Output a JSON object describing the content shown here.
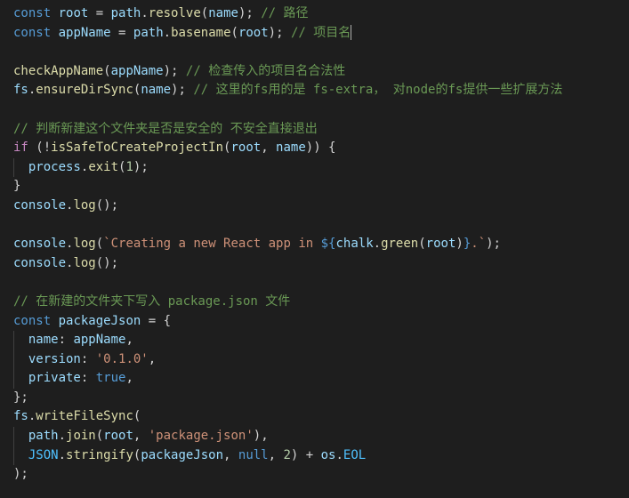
{
  "editor": {
    "lines": [
      [
        [
          "k",
          "const"
        ],
        [
          "p",
          " "
        ],
        [
          "v",
          "root"
        ],
        [
          "p",
          " = "
        ],
        [
          "v",
          "path"
        ],
        [
          "p",
          "."
        ],
        [
          "f",
          "resolve"
        ],
        [
          "p",
          "("
        ],
        [
          "v",
          "name"
        ],
        [
          "p",
          "); "
        ],
        [
          "c",
          "// 路径"
        ]
      ],
      [
        [
          "k",
          "const"
        ],
        [
          "p",
          " "
        ],
        [
          "v",
          "appName"
        ],
        [
          "p",
          " = "
        ],
        [
          "v",
          "path"
        ],
        [
          "p",
          "."
        ],
        [
          "f",
          "basename"
        ],
        [
          "p",
          "("
        ],
        [
          "v",
          "root"
        ],
        [
          "p",
          "); "
        ],
        [
          "c",
          "// 项目名"
        ]
      ],
      [],
      [
        [
          "f",
          "checkAppName"
        ],
        [
          "p",
          "("
        ],
        [
          "v",
          "appName"
        ],
        [
          "p",
          "); "
        ],
        [
          "c",
          "// 检查传入的项目名合法性"
        ]
      ],
      [
        [
          "v",
          "fs"
        ],
        [
          "p",
          "."
        ],
        [
          "f",
          "ensureDirSync"
        ],
        [
          "p",
          "("
        ],
        [
          "v",
          "name"
        ],
        [
          "p",
          "); "
        ],
        [
          "c",
          "// 这里的fs用的是 fs-extra， 对node的fs提供一些扩展方法"
        ]
      ],
      [],
      [
        [
          "c",
          "// 判断新建这个文件夹是否是安全的 不安全直接退出"
        ]
      ],
      [
        [
          "kc",
          "if"
        ],
        [
          "p",
          " (!"
        ],
        [
          "f",
          "isSafeToCreateProjectIn"
        ],
        [
          "p",
          "("
        ],
        [
          "v",
          "root"
        ],
        [
          "p",
          ", "
        ],
        [
          "v",
          "name"
        ],
        [
          "p",
          ")) {"
        ]
      ],
      [
        [
          "p",
          "  "
        ],
        [
          "v",
          "process"
        ],
        [
          "p",
          "."
        ],
        [
          "f",
          "exit"
        ],
        [
          "p",
          "("
        ],
        [
          "n",
          "1"
        ],
        [
          "p",
          ");"
        ]
      ],
      [
        [
          "p",
          "}"
        ]
      ],
      [
        [
          "v",
          "console"
        ],
        [
          "p",
          "."
        ],
        [
          "f",
          "log"
        ],
        [
          "p",
          "();"
        ]
      ],
      [],
      [
        [
          "v",
          "console"
        ],
        [
          "p",
          "."
        ],
        [
          "f",
          "log"
        ],
        [
          "p",
          "("
        ],
        [
          "s",
          "`Creating a new React app in "
        ],
        [
          "k",
          "${"
        ],
        [
          "v",
          "chalk"
        ],
        [
          "p",
          "."
        ],
        [
          "f",
          "green"
        ],
        [
          "p",
          "("
        ],
        [
          "v",
          "root"
        ],
        [
          "p",
          ")"
        ],
        [
          "k",
          "}"
        ],
        [
          "s",
          ".`"
        ],
        [
          "p",
          ");"
        ]
      ],
      [
        [
          "v",
          "console"
        ],
        [
          "p",
          "."
        ],
        [
          "f",
          "log"
        ],
        [
          "p",
          "();"
        ]
      ],
      [],
      [
        [
          "c",
          "// 在新建的文件夹下写入 package.json 文件"
        ]
      ],
      [
        [
          "k",
          "const"
        ],
        [
          "p",
          " "
        ],
        [
          "v",
          "packageJson"
        ],
        [
          "p",
          " = {"
        ]
      ],
      [
        [
          "p",
          "  "
        ],
        [
          "v",
          "name"
        ],
        [
          "p",
          ": "
        ],
        [
          "v",
          "appName"
        ],
        [
          "p",
          ","
        ]
      ],
      [
        [
          "p",
          "  "
        ],
        [
          "v",
          "version"
        ],
        [
          "p",
          ": "
        ],
        [
          "s",
          "'0.1.0'"
        ],
        [
          "p",
          ","
        ]
      ],
      [
        [
          "p",
          "  "
        ],
        [
          "v",
          "private"
        ],
        [
          "p",
          ": "
        ],
        [
          "t",
          "true"
        ],
        [
          "p",
          ","
        ]
      ],
      [
        [
          "p",
          "};"
        ]
      ],
      [
        [
          "v",
          "fs"
        ],
        [
          "p",
          "."
        ],
        [
          "f",
          "writeFileSync"
        ],
        [
          "p",
          "("
        ]
      ],
      [
        [
          "p",
          "  "
        ],
        [
          "v",
          "path"
        ],
        [
          "p",
          "."
        ],
        [
          "f",
          "join"
        ],
        [
          "p",
          "("
        ],
        [
          "v",
          "root"
        ],
        [
          "p",
          ", "
        ],
        [
          "s",
          "'package.json'"
        ],
        [
          "p",
          "),"
        ]
      ],
      [
        [
          "p",
          "  "
        ],
        [
          "cn",
          "JSON"
        ],
        [
          "p",
          "."
        ],
        [
          "f",
          "stringify"
        ],
        [
          "p",
          "("
        ],
        [
          "v",
          "packageJson"
        ],
        [
          "p",
          ", "
        ],
        [
          "k",
          "null"
        ],
        [
          "p",
          ", "
        ],
        [
          "n",
          "2"
        ],
        [
          "p",
          ") + "
        ],
        [
          "v",
          "os"
        ],
        [
          "p",
          "."
        ],
        [
          "cn",
          "EOL"
        ]
      ],
      [
        [
          "p",
          ");"
        ]
      ]
    ]
  }
}
